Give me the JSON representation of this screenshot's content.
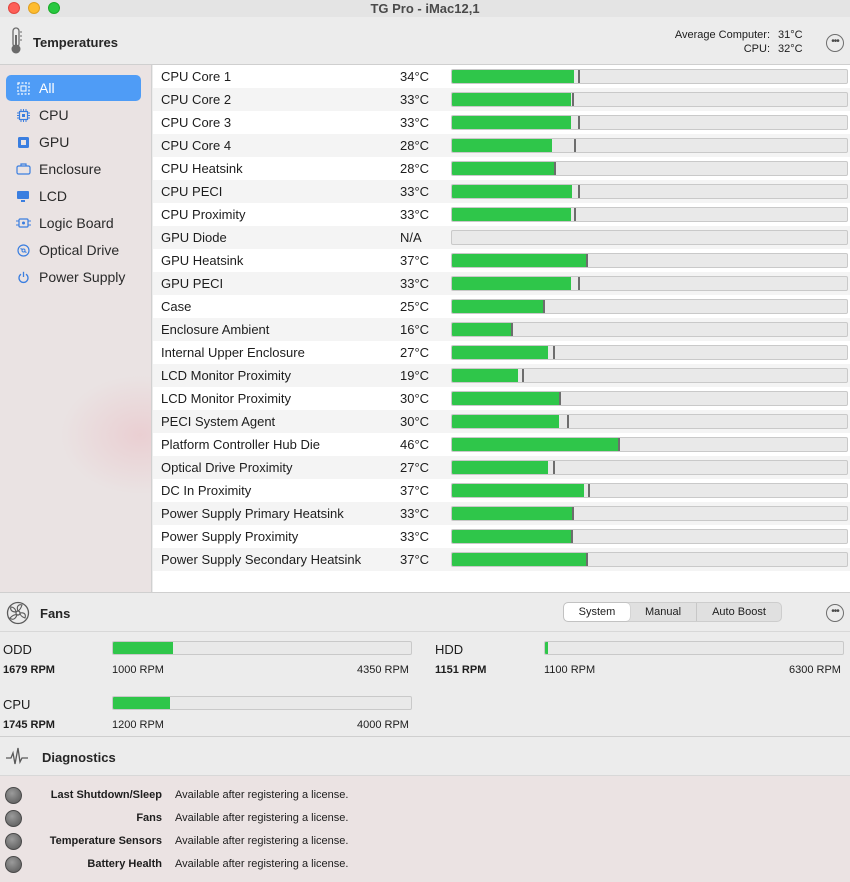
{
  "window": {
    "title": "TG Pro - iMac12,1"
  },
  "temperatures": {
    "title": "Temperatures",
    "average_label": "Average Computer:",
    "average_value": "31°C",
    "cpu_label": "CPU:",
    "cpu_value": "32°C"
  },
  "sidebar": {
    "items": [
      {
        "label": "All",
        "icon": "all-icon"
      },
      {
        "label": "CPU",
        "icon": "cpu-icon"
      },
      {
        "label": "GPU",
        "icon": "gpu-icon"
      },
      {
        "label": "Enclosure",
        "icon": "enclosure-icon"
      },
      {
        "label": "LCD",
        "icon": "lcd-icon"
      },
      {
        "label": "Logic Board",
        "icon": "logic-board-icon"
      },
      {
        "label": "Optical Drive",
        "icon": "optical-drive-icon"
      },
      {
        "label": "Power Supply",
        "icon": "power-supply-icon"
      }
    ],
    "selected": "All",
    "selected_color": "#4f9cf6"
  },
  "sensors": [
    {
      "name": "CPU Core 1",
      "value": "34°C",
      "level": 0.31,
      "max": 0.32
    },
    {
      "name": "CPU Core 2",
      "value": "33°C",
      "level": 0.3,
      "max": 0.305
    },
    {
      "name": "CPU Core 3",
      "value": "33°C",
      "level": 0.3,
      "max": 0.32
    },
    {
      "name": "CPU Core 4",
      "value": "28°C",
      "level": 0.253,
      "max": 0.308
    },
    {
      "name": "CPU Heatsink",
      "value": "28°C",
      "level": 0.258,
      "max": 0.258
    },
    {
      "name": "CPU PECI",
      "value": "33°C",
      "level": 0.303,
      "max": 0.32
    },
    {
      "name": "CPU Proximity",
      "value": "33°C",
      "level": 0.3,
      "max": 0.308
    },
    {
      "name": "GPU Diode",
      "value": "N/A",
      "level": 0,
      "max": null
    },
    {
      "name": "GPU Heatsink",
      "value": "37°C",
      "level": 0.338,
      "max": 0.338
    },
    {
      "name": "GPU PECI",
      "value": "33°C",
      "level": 0.3,
      "max": 0.32
    },
    {
      "name": "Case",
      "value": "25°C",
      "level": 0.23,
      "max": 0.23
    },
    {
      "name": "Enclosure Ambient",
      "value": "16°C",
      "level": 0.15,
      "max": 0.15
    },
    {
      "name": "Internal Upper Enclosure",
      "value": "27°C",
      "level": 0.242,
      "max": 0.255
    },
    {
      "name": "LCD Monitor Proximity",
      "value": "19°C",
      "level": 0.167,
      "max": 0.178
    },
    {
      "name": "LCD Monitor Proximity",
      "value": "30°C",
      "level": 0.27,
      "max": 0.27
    },
    {
      "name": "PECI System Agent",
      "value": "30°C",
      "level": 0.27,
      "max": 0.29
    },
    {
      "name": "Platform Controller Hub Die",
      "value": "46°C",
      "level": 0.42,
      "max": 0.42
    },
    {
      "name": "Optical Drive Proximity",
      "value": "27°C",
      "level": 0.242,
      "max": 0.255
    },
    {
      "name": "DC In Proximity",
      "value": "37°C",
      "level": 0.335,
      "max": 0.345
    },
    {
      "name": "Power Supply Primary Heatsink",
      "value": "33°C",
      "level": 0.303,
      "max": 0.303
    },
    {
      "name": "Power Supply Proximity",
      "value": "33°C",
      "level": 0.3,
      "max": 0.302
    },
    {
      "name": "Power Supply Secondary Heatsink",
      "value": "37°C",
      "level": 0.338,
      "max": 0.338
    }
  ],
  "fans": {
    "title": "Fans",
    "modes": [
      "System",
      "Manual",
      "Auto Boost"
    ],
    "selected_mode": "System",
    "items": [
      {
        "name": "ODD",
        "rpm": "1679 RPM",
        "min": "1000 RPM",
        "max": "4350 RPM",
        "level": 0.2
      },
      {
        "name": "HDD",
        "rpm": "1151 RPM",
        "min": "1100 RPM",
        "max": "6300 RPM",
        "level": 0.01
      },
      {
        "name": "CPU",
        "rpm": "1745 RPM",
        "min": "1200 RPM",
        "max": "4000 RPM",
        "level": 0.19
      }
    ]
  },
  "diagnostics": {
    "title": "Diagnostics",
    "rows": [
      {
        "label": "Last Shutdown/Sleep",
        "value": "Available after registering a license."
      },
      {
        "label": "Fans",
        "value": "Available after registering a license."
      },
      {
        "label": "Temperature Sensors",
        "value": "Available after registering a license."
      },
      {
        "label": "Battery Health",
        "value": "Available after registering a license."
      }
    ]
  },
  "colors": {
    "bar_fill": "#2fc64a",
    "accent": "#4f9cf6"
  }
}
